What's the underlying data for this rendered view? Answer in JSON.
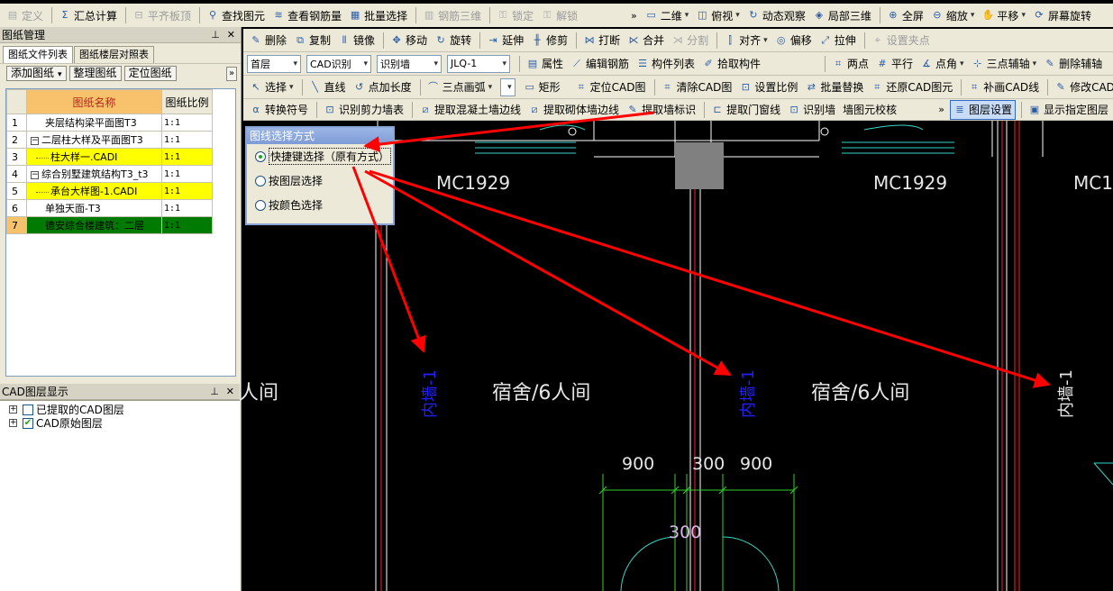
{
  "toolbar1": {
    "items": [
      {
        "label": "定义",
        "icon": "define-icon",
        "disabled": true
      },
      {
        "label": "汇总计算",
        "icon": "sum-icon",
        "disabled": false
      },
      {
        "label": "平齐板顶",
        "icon": "align-slab-icon",
        "disabled": true
      },
      {
        "label": "查找图元",
        "icon": "find-binoculars-icon",
        "disabled": false
      },
      {
        "label": "查看钢筋量",
        "icon": "view-rebar-icon",
        "disabled": false
      },
      {
        "label": "批量选择",
        "icon": "batch-select-icon",
        "disabled": false
      },
      {
        "label": "钢筋三维",
        "icon": "rebar-3d-icon",
        "disabled": true
      },
      {
        "label": "锁定",
        "icon": "lock-icon",
        "disabled": true
      },
      {
        "label": "解锁",
        "icon": "unlock-icon",
        "disabled": true
      }
    ],
    "right_items": [
      {
        "label": "二维",
        "icon": "2d-icon",
        "dropdown": true
      },
      {
        "label": "俯视",
        "icon": "top-view-icon",
        "dropdown": true
      },
      {
        "label": "动态观察",
        "icon": "orbit-icon",
        "dropdown": false
      },
      {
        "label": "局部三维",
        "icon": "local-3d-icon",
        "dropdown": false
      },
      {
        "label": "全屏",
        "icon": "fullscreen-icon",
        "dropdown": false
      },
      {
        "label": "缩放",
        "icon": "zoom-icon",
        "dropdown": true
      },
      {
        "label": "平移",
        "icon": "pan-hand-icon",
        "dropdown": true
      },
      {
        "label": "屏幕旋转",
        "icon": "rotate-screen-icon",
        "dropdown": false
      }
    ]
  },
  "toolbar2": {
    "items": [
      {
        "label": "删除",
        "icon": "delete-icon"
      },
      {
        "label": "复制",
        "icon": "copy-icon"
      },
      {
        "label": "镜像",
        "icon": "mirror-icon"
      },
      {
        "label": "移动",
        "icon": "move-icon"
      },
      {
        "label": "旋转",
        "icon": "rotate-icon"
      },
      {
        "label": "延伸",
        "icon": "extend-icon"
      },
      {
        "label": "修剪",
        "icon": "trim-icon"
      },
      {
        "label": "打断",
        "icon": "break-icon"
      },
      {
        "label": "合并",
        "icon": "merge-icon"
      },
      {
        "label": "分割",
        "icon": "split-icon",
        "disabled": true
      },
      {
        "label": "对齐",
        "icon": "align-icon",
        "dropdown": true
      },
      {
        "label": "偏移",
        "icon": "offset-icon"
      },
      {
        "label": "拉伸",
        "icon": "stretch-icon"
      },
      {
        "label": "设置夹点",
        "icon": "grip-icon",
        "disabled": true
      }
    ]
  },
  "toolbar3": {
    "floor": "首层",
    "cad_recognize": "CAD识别",
    "recognize_wall": "识别墙",
    "wall_type": "JLQ-1",
    "items": [
      {
        "label": "属性",
        "icon": "properties-icon"
      },
      {
        "label": "编辑钢筋",
        "icon": "edit-rebar-icon"
      },
      {
        "label": "构件列表",
        "icon": "component-list-icon"
      },
      {
        "label": "拾取构件",
        "icon": "pick-component-icon"
      }
    ],
    "right_items": [
      {
        "label": "两点",
        "icon": "two-point-icon"
      },
      {
        "label": "平行",
        "icon": "parallel-icon"
      },
      {
        "label": "点角",
        "icon": "point-angle-icon",
        "dropdown": true
      },
      {
        "label": "三点辅轴",
        "icon": "three-point-axis-icon",
        "dropdown": true
      },
      {
        "label": "删除辅轴",
        "icon": "delete-axis-icon"
      }
    ]
  },
  "toolbar4": {
    "items": [
      {
        "label": "选择",
        "icon": "select-arrow-icon",
        "dropdown": true
      },
      {
        "label": "直线",
        "icon": "line-icon"
      },
      {
        "label": "点加长度",
        "icon": "point-length-icon"
      },
      {
        "label": "三点画弧",
        "icon": "three-point-arc-icon",
        "dropdown": true
      }
    ],
    "rect_label": "矩形",
    "right_items": [
      {
        "label": "定位CAD图",
        "icon": "locate-cad-icon"
      },
      {
        "label": "清除CAD图",
        "icon": "clear-cad-icon"
      },
      {
        "label": "设置比例",
        "icon": "set-scale-icon"
      },
      {
        "label": "批量替换",
        "icon": "batch-replace-icon"
      },
      {
        "label": "还原CAD图元",
        "icon": "restore-cad-icon"
      },
      {
        "label": "补画CAD线",
        "icon": "draw-cad-line-icon"
      },
      {
        "label": "修改CAD",
        "icon": "modify-cad-icon"
      }
    ]
  },
  "toolbar5": {
    "items": [
      {
        "label": "转换符号",
        "icon": "convert-symbol-icon"
      },
      {
        "label": "识别剪力墙表",
        "icon": "shear-wall-table-icon"
      },
      {
        "label": "提取混凝土墙边线",
        "icon": "extract-concrete-wall-icon"
      },
      {
        "label": "提取砌体墙边线",
        "icon": "extract-masonry-wall-icon"
      },
      {
        "label": "提取墙标识",
        "icon": "extract-wall-label-icon"
      },
      {
        "label": "提取门窗线",
        "icon": "extract-door-window-icon"
      },
      {
        "label": "识别墙",
        "icon": "recognize-wall-icon"
      },
      {
        "label": "墙图元校核",
        "icon": ""
      }
    ],
    "right_items": [
      {
        "label": "图层设置",
        "icon": "layer-settings-icon",
        "active": true
      },
      {
        "label": "显示指定图层",
        "icon": "show-layer-icon"
      }
    ]
  },
  "left_panel": {
    "title": "图纸管理",
    "tabs": [
      "图纸文件列表",
      "图纸楼层对照表"
    ],
    "buttons": [
      {
        "label": "添加图纸",
        "dropdown": true
      },
      {
        "label": "整理图纸",
        "dropdown": false
      },
      {
        "label": "定位图纸",
        "dropdown": false
      }
    ],
    "headers": {
      "name": "图纸名称",
      "scale": "图纸比例"
    },
    "rows": [
      {
        "idx": "1",
        "name": "夹层结构梁平面图T3",
        "scale": "1:1",
        "style": "",
        "indent": 0,
        "toggle": ""
      },
      {
        "idx": "2",
        "name": "二层柱大样及平面图T3",
        "scale": "1:1",
        "style": "",
        "indent": 0,
        "toggle": "−"
      },
      {
        "idx": "3",
        "name": "柱大样一.CADI",
        "scale": "1:1",
        "style": "y",
        "indent": 1,
        "toggle": ""
      },
      {
        "idx": "4",
        "name": "综合别墅建筑结构T3_t3",
        "scale": "1:1",
        "style": "",
        "indent": 0,
        "toggle": "−"
      },
      {
        "idx": "5",
        "name": "承台大样图-1.CADI",
        "scale": "1:1",
        "style": "y",
        "indent": 1,
        "toggle": ""
      },
      {
        "idx": "6",
        "name": "单独天面-T3",
        "scale": "1:1",
        "style": "",
        "indent": 0,
        "toggle": ""
      },
      {
        "idx": "7",
        "name": "德安综合楼建筑：二层",
        "scale": "1:1",
        "style": "g",
        "indent": 0,
        "toggle": ""
      }
    ]
  },
  "layer_panel": {
    "title": "CAD图层显示",
    "items": [
      {
        "label": "已提取的CAD图层",
        "checked": false
      },
      {
        "label": "CAD原始图层",
        "checked": true
      }
    ]
  },
  "dialog": {
    "title": "图线选择方式",
    "options": [
      {
        "label": "快捷键选择（原有方式）",
        "selected": true
      },
      {
        "label": "按图层选择",
        "selected": false
      },
      {
        "label": "按颜色选择",
        "selected": false
      }
    ]
  },
  "canvas": {
    "door_labels": [
      "MC1929",
      "MC1929",
      "MC1"
    ],
    "room_labels": [
      "人间",
      "宿舍/6人间",
      "宿舍/6人间"
    ],
    "wall_labels": [
      "内墙-1",
      "内墙-1",
      "内墙-1"
    ],
    "dims": [
      "900",
      "300",
      "900",
      "300"
    ],
    "colors": {
      "wall_label_blue": "#2020ff",
      "arrow_red": "#ff0000",
      "line_red": "#ff2020",
      "cyan": "#35d6c8",
      "green": "#2fd12f",
      "gray_block": "#808080"
    }
  }
}
